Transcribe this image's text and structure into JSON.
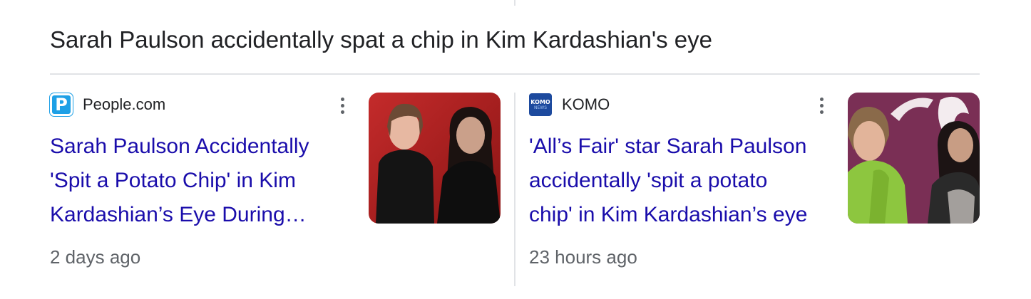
{
  "headline": "Sarah Paulson accidentally spat a chip in Kim Kardashian's eye",
  "articles": [
    {
      "source": "People.com",
      "favicon_letter": "P",
      "favicon_color": "#1ea0e6",
      "title_lines": [
        "Sarah Paulson Accidentally",
        "'Spit a Potato Chip' in Kim",
        "Kardashian’s Eye During…"
      ],
      "time": "2 days ago",
      "more_icon": "more-vert-icon",
      "thumbnail_icon": "article-thumbnail"
    },
    {
      "source": "KOMO",
      "favicon_text_top": "KOMO",
      "favicon_text_bottom": "NEWS",
      "favicon_color": "#1d4a9e",
      "title_lines": [
        "'All’s Fair' star Sarah Paulson",
        "accidentally 'spit a potato",
        "chip' in Kim Kardashian’s eye"
      ],
      "time": "23 hours ago",
      "more_icon": "more-vert-icon",
      "thumbnail_icon": "article-thumbnail"
    }
  ],
  "colors": {
    "link": "#1a0dab",
    "text": "#202124",
    "muted": "#5f6368",
    "divider": "#e1e3e6"
  }
}
